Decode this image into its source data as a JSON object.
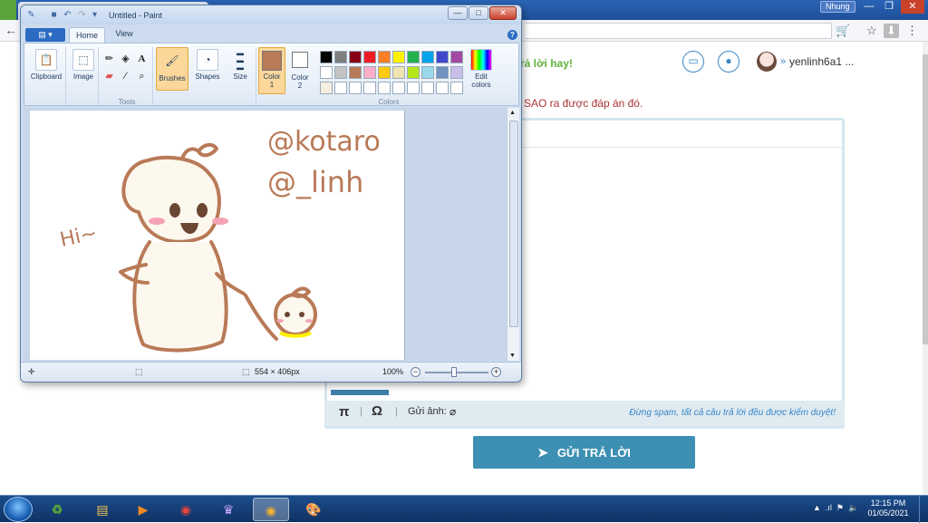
{
  "browser": {
    "profile_name": "Nhung",
    "window_buttons": [
      "—",
      "❐",
      "✕"
    ],
    "back_icon": "←",
    "toolbar_icons": [
      "cart-icon",
      "translate-icon",
      "star-icon",
      "download-icon",
      "menu-icon"
    ],
    "toolbar_glyphs": [
      "🛒",
      "☆",
      "⬇",
      "⋮"
    ]
  },
  "site": {
    "greeting": "rả lời hay!",
    "username": "yenlinh6a1 ...",
    "username_chevron": "»",
    "note": "SAO ra được đáp án đó.",
    "editor": {
      "pi": "π",
      "omega": "Ω",
      "separator": "|",
      "attach_label": "Gửi ảnh:",
      "spam_note": "Đừng spam, tất cả câu trả lời đều được kiểm duyệt!"
    },
    "send_button": "GỬI TRẢ LỜI",
    "accent_color": "#3d8fb3",
    "greeting_color": "#63b13d"
  },
  "paint": {
    "title": "Untitled - Paint",
    "window_buttons": [
      "—",
      "□",
      "✕"
    ],
    "tabs": [
      "Home",
      "View"
    ],
    "file_tab": "▤ ▾",
    "help": "?",
    "groups": {
      "clipboard": "Clipboard",
      "image": "Image",
      "tools": "Tools",
      "brushes": "Brushes",
      "shapes": "Shapes",
      "size": "Size",
      "color1": "Color 1",
      "color2": "Color 2",
      "colors": "Colors",
      "edit_colors": "Edit colors"
    },
    "palette_row1": [
      "#000000",
      "#7f7f7f",
      "#880015",
      "#ed1c24",
      "#ff7f27",
      "#fff200",
      "#22b14c",
      "#00a2e8",
      "#3f48cc",
      "#a349a4"
    ],
    "palette_row2": [
      "#ffffff",
      "#c3c3c3",
      "#b97a57",
      "#ffaec9",
      "#ffc90e",
      "#efe4b0",
      "#b5e61d",
      "#99d9ea",
      "#7092be",
      "#c8bfe7"
    ],
    "palette_row3": [
      "#f5efde",
      "#ffffff",
      "#ffffff",
      "#ffffff",
      "#ffffff",
      "#ffffff",
      "#ffffff",
      "#ffffff",
      "#ffffff",
      "#ffffff"
    ],
    "color1": "#b97a57",
    "color2": "#ffffff",
    "drawing": {
      "handle1": "@kotaro",
      "handle2": "@_linh",
      "greeting": "Hi~"
    },
    "status": {
      "dimensions": "554 × 406px",
      "zoom": "100%"
    }
  },
  "taskbar": {
    "clock_time": "12:15 PM",
    "clock_date": "01/05/2021",
    "apps": [
      "hoc24-icon",
      "file-explorer-icon",
      "media-player-icon",
      "chrome-icon",
      "game-icon",
      "chrome-active-icon",
      "paint-icon"
    ]
  }
}
